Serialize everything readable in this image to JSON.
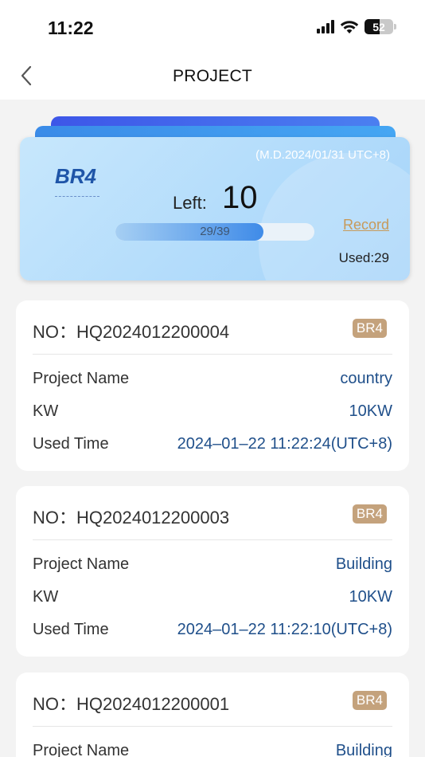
{
  "status_bar": {
    "time": "11:22",
    "battery": "52",
    "battery_level": 0.52
  },
  "header": {
    "title": "PROJECT"
  },
  "summary": {
    "date": "(M.D.2024/01/31 UTC+8)",
    "model": "BR4",
    "left_label": "Left:",
    "left_value": "10",
    "progress_text": "29/39",
    "progress_fraction": 0.744,
    "record_label": "Record",
    "used_text": "Used:29"
  },
  "colors": {
    "accent_blue": "#1f55a8",
    "tag_gold": "#c4a27c",
    "record_link": "#c79a5a"
  },
  "records": [
    {
      "no": "NO：HQ2024012200004",
      "tag": "BR4",
      "fields": [
        {
          "label": "Project Name",
          "value": "country"
        },
        {
          "label": "KW",
          "value": "10KW"
        },
        {
          "label": "Used Time",
          "value": "2024–01–22 11:22:24(UTC+8)"
        }
      ]
    },
    {
      "no": "NO：HQ2024012200003",
      "tag": "BR4",
      "fields": [
        {
          "label": "Project Name",
          "value": "Building"
        },
        {
          "label": "KW",
          "value": "10KW"
        },
        {
          "label": "Used Time",
          "value": "2024–01–22 11:22:10(UTC+8)"
        }
      ]
    },
    {
      "no": "NO：HQ2024012200001",
      "tag": "BR4",
      "fields": [
        {
          "label": "Project Name",
          "value": "Building"
        }
      ]
    }
  ]
}
